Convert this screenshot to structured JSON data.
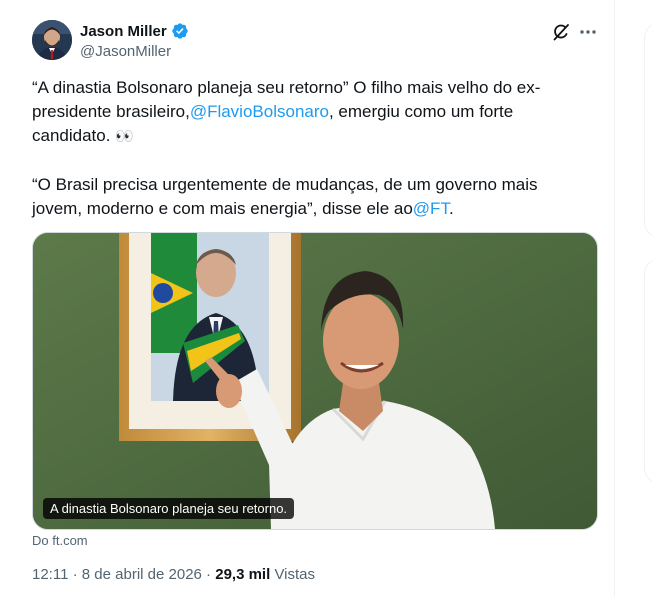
{
  "author": {
    "name": "Jason Miller",
    "handle": "@JasonMiller",
    "verified": true,
    "verified_color": "#1d9bf0"
  },
  "tweet": {
    "p1_a": "“A dinastia Bolsonaro planeja seu retorno” O filho mais velho do ex-presidente brasileiro,",
    "p1_mention": "@FlavioBolsonaro",
    "p1_b": ", emergiu como um forte candidato. ",
    "p1_emoji": "👀",
    "p2_a": "“O Brasil precisa urgentemente de mudanças, de um governo mais jovem, moderno e com mais energia”, disse ele ao",
    "p2_mention": "@FT",
    "p2_b": "."
  },
  "media": {
    "caption": "A dinastia Bolsonaro planeja seu retorno.",
    "source": "Do ft.com"
  },
  "meta": {
    "time": "12:11",
    "sep1": " · ",
    "date": "8 de abril de 2026",
    "sep2": " · ",
    "views_count": "29,3 mil",
    "views_label": " Vistas"
  },
  "icons": {
    "verified": "verified-badge-icon",
    "grok": "grok-icon",
    "more": "more-options-icon"
  },
  "colors": {
    "link": "#1d9bf0",
    "secondary_text": "#536471",
    "primary_text": "#0f1419"
  }
}
